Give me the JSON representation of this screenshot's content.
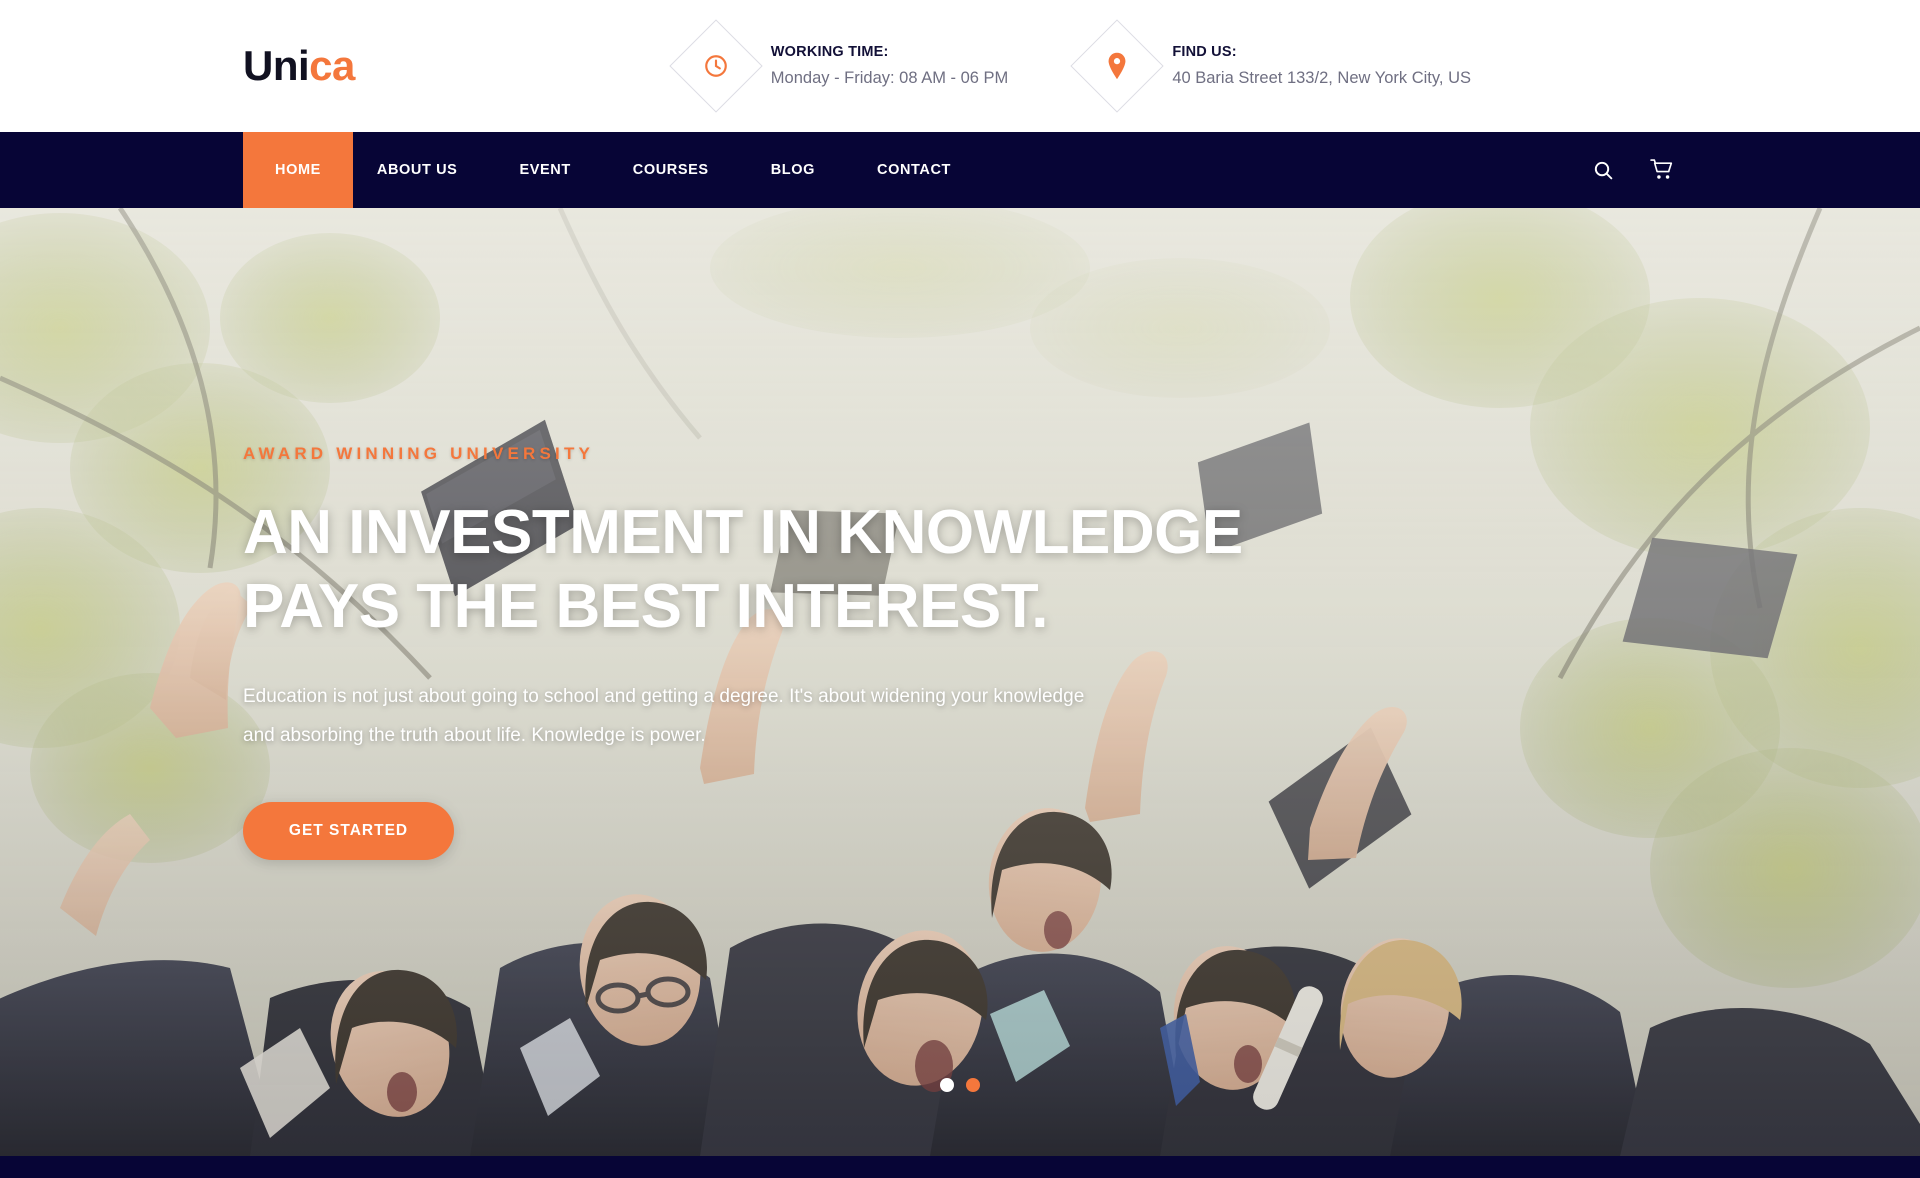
{
  "brand": {
    "name_dark": "Uni",
    "name_accent": "ca"
  },
  "colors": {
    "accent": "#f4773c",
    "navy": "#070536",
    "muted_text": "#6f6f82",
    "heading_dark": "#121037"
  },
  "topbar": {
    "working": {
      "icon": "clock-icon",
      "title": "WORKING TIME:",
      "value": "Monday - Friday: 08 AM - 06 PM"
    },
    "location": {
      "icon": "map-pin-icon",
      "title": "FIND US:",
      "value": "40 Baria Street 133/2, New York City, US"
    }
  },
  "nav": {
    "items": [
      {
        "label": "HOME",
        "active": true
      },
      {
        "label": "ABOUT US",
        "active": false
      },
      {
        "label": "EVENT",
        "active": false
      },
      {
        "label": "COURSES",
        "active": false
      },
      {
        "label": "BLOG",
        "active": false
      },
      {
        "label": "CONTACT",
        "active": false
      }
    ],
    "icons": [
      {
        "name": "search-icon"
      },
      {
        "name": "cart-icon"
      }
    ]
  },
  "hero": {
    "eyebrow": "AWARD WINNING UNIVERSITY",
    "title_line1": "AN INVESTMENT IN KNOWLEDGE",
    "title_line2": "PAYS THE BEST INTEREST.",
    "description": "Education is not just about going to school and getting a degree. It's about widening your knowledge and absorbing the truth about life. Knowledge is power.",
    "cta_label": "GET STARTED",
    "slides": [
      {
        "index": 1,
        "state": "white"
      },
      {
        "index": 2,
        "state": "orange"
      }
    ]
  }
}
